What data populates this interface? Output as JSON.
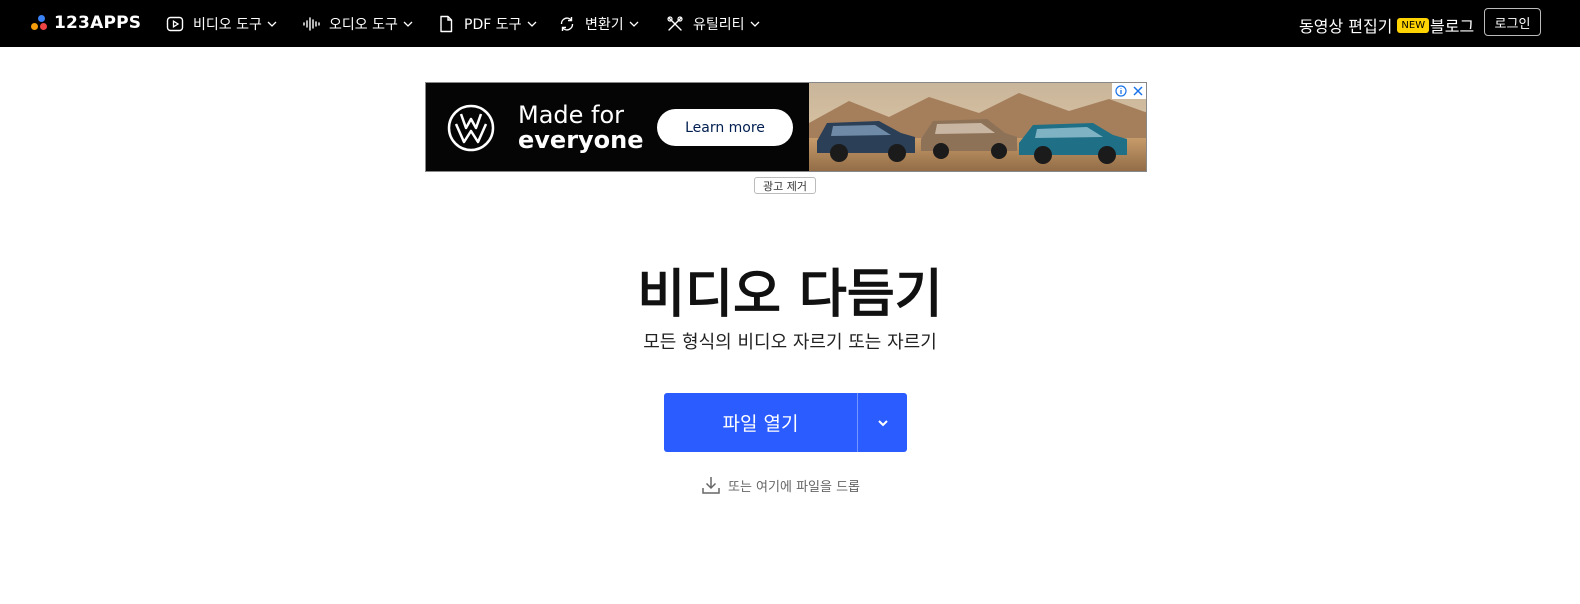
{
  "brand": {
    "name": "123APPS"
  },
  "nav": {
    "items": [
      {
        "label": "비디오 도구",
        "icon": "play-circle-icon"
      },
      {
        "label": "오디오 도구",
        "icon": "waveform-icon"
      },
      {
        "label": "PDF 도구",
        "icon": "document-icon"
      },
      {
        "label": "변환기",
        "icon": "refresh-icon"
      },
      {
        "label": "유틸리티",
        "icon": "tools-icon"
      }
    ],
    "editor_label": "동영상 편집기",
    "editor_badge": "NEW",
    "blog_label": "블로그",
    "login_label": "로그인"
  },
  "ad": {
    "headline_line1": "Made for",
    "headline_line2": "everyone",
    "cta": "Learn more",
    "remove_ads": "광고 제거"
  },
  "main": {
    "title": "비디오 다듬기",
    "subtitle": "모든 형식의 비디오 자르기 또는 자르기",
    "open_button": "파일 열기",
    "drop_hint": "또는 여기에 파일을 드롭"
  },
  "colors": {
    "topbar": "#000000",
    "primary_button": "#2b5cff",
    "badge": "#ffd400"
  }
}
